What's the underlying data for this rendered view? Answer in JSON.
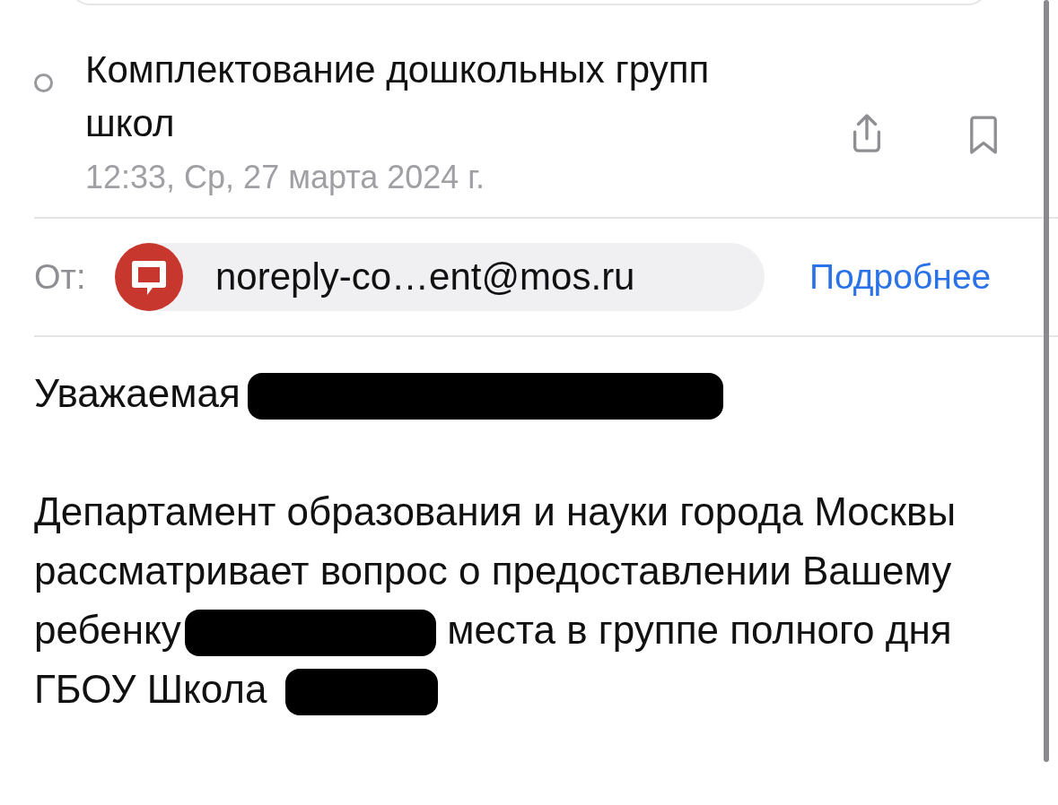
{
  "message": {
    "unread": false,
    "subject": "Комплектование дошкольных групп школ",
    "date": "12:33, Ср, 27 марта 2024 г."
  },
  "sender": {
    "label": "От:",
    "address": "noreply-co…ent@mos.ru",
    "details_link": "Подробнее"
  },
  "body": {
    "greeting": [
      {
        "kind": "text",
        "text": "Уважаемая"
      },
      {
        "kind": "redaction"
      }
    ],
    "paragraph": [
      {
        "kind": "text",
        "text": "Департамент образования и науки города Москвы рассматривает вопрос о предоставлении Вашему ребенку"
      },
      {
        "kind": "redaction"
      },
      {
        "kind": "text",
        "text": "места в группе полного дня ГБОУ Школа"
      },
      {
        "kind": "redaction"
      }
    ]
  }
}
